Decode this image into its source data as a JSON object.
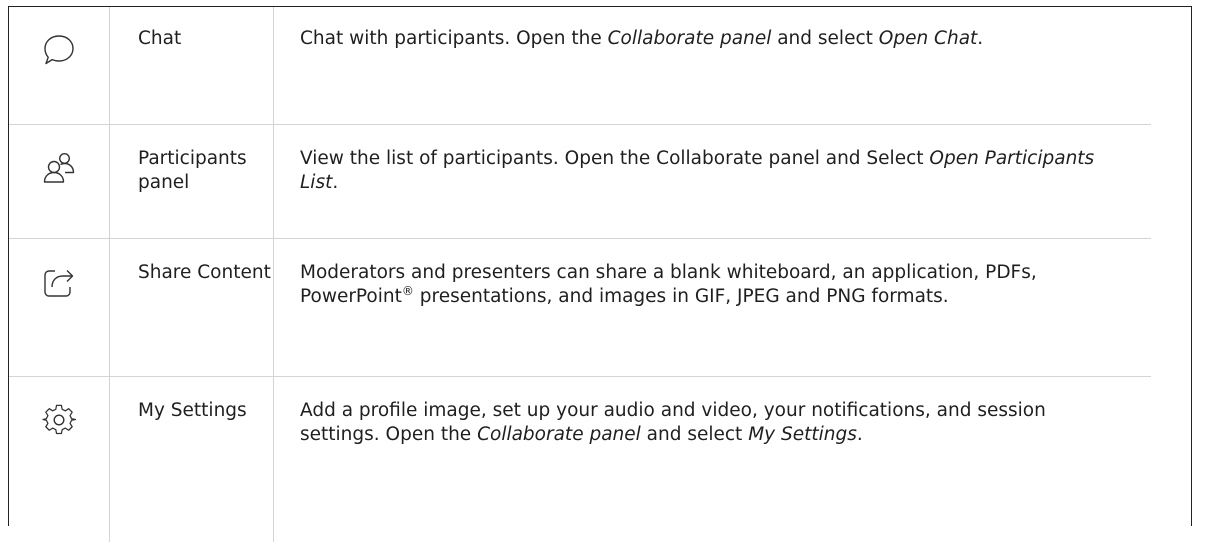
{
  "rows": [
    {
      "icon": "chat-bubble-icon",
      "name": "Chat",
      "desc": [
        {
          "t": "Chat with participants. Open the "
        },
        {
          "t": "Collaborate panel",
          "em": true
        },
        {
          "t": " and select "
        },
        {
          "t": "Open Chat",
          "em": true
        },
        {
          "t": "."
        }
      ]
    },
    {
      "icon": "participants-icon",
      "name": "Participants panel",
      "desc": [
        {
          "t": "View the list of participants. Open the Collaborate panel and Select "
        },
        {
          "t": "Open Participants List",
          "em": true
        },
        {
          "t": "."
        }
      ]
    },
    {
      "icon": "share-icon",
      "name": "Share Content",
      "desc": [
        {
          "t": "Moderators and presenters can share a blank whiteboard, an application, PDFs, PowerPoint"
        },
        {
          "t": "®",
          "sup": true
        },
        {
          "t": " presentations, and images in GIF, JPEG and PNG formats."
        }
      ]
    },
    {
      "icon": "gear-icon",
      "name": "My Settings",
      "desc": [
        {
          "t": "Add a profile image, set up your audio and video, your notifications, and session settings. Open the "
        },
        {
          "t": "Collaborate panel",
          "em": true
        },
        {
          "t": " and select "
        },
        {
          "t": "My Settings",
          "em": true
        },
        {
          "t": "."
        }
      ]
    }
  ]
}
